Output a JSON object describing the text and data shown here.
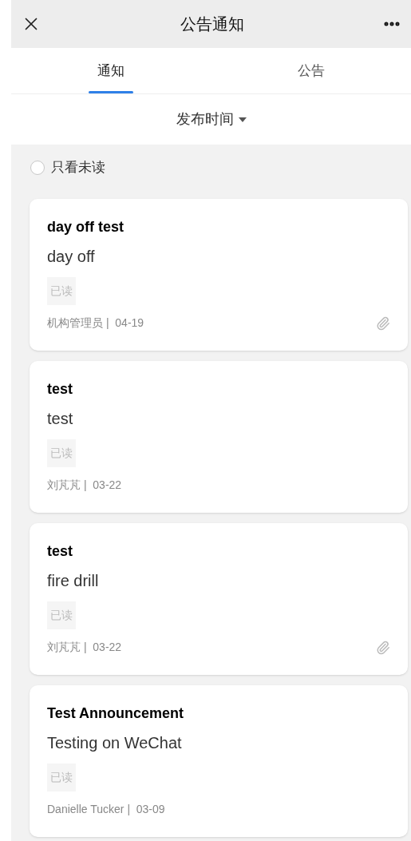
{
  "header": {
    "title": "公告通知"
  },
  "tabs": [
    {
      "label": "通知",
      "selected": true
    },
    {
      "label": "公告",
      "selected": false
    }
  ],
  "sort": {
    "label": "发布时间"
  },
  "filter": {
    "label": "只看未读",
    "checked": false
  },
  "notices": [
    {
      "title": "day off test",
      "body": "day off",
      "tag": "已读",
      "meta": "机构管理员 |  04-19",
      "attachment": true
    },
    {
      "title": "test",
      "body": "test",
      "tag": "已读",
      "meta": "刘芃芃 |  03-22",
      "attachment": false
    },
    {
      "title": "test",
      "body": "fire drill",
      "tag": "已读",
      "meta": "刘芃芃 |  03-22",
      "attachment": true
    },
    {
      "title": "Test Announcement",
      "body": "Testing on WeChat",
      "tag": "已读",
      "meta": "Danielle Tucker |  03-09",
      "attachment": false
    }
  ]
}
